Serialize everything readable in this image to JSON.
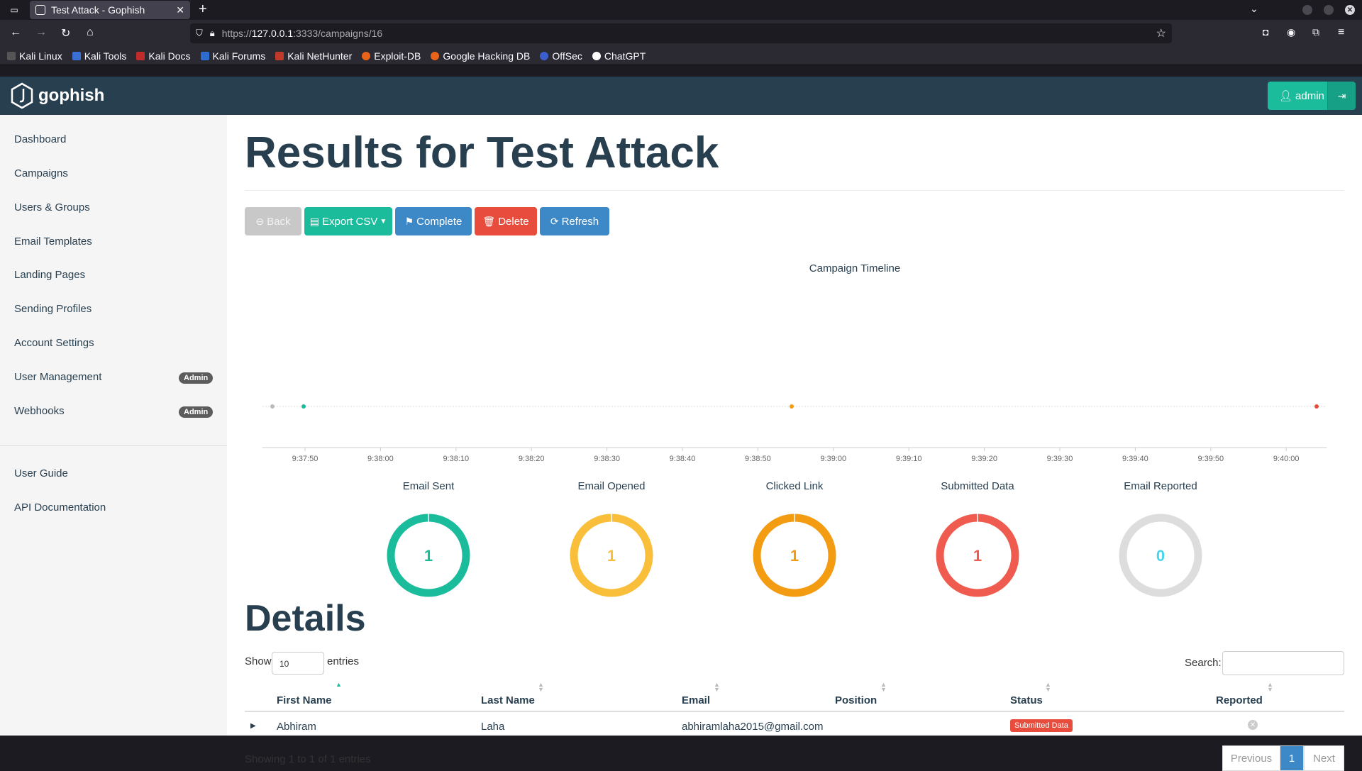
{
  "browser": {
    "tab_title": "Test Attack - Gophish",
    "url_prefix": "https://",
    "url_host": "127.0.0.1",
    "url_rest": ":3333/campaigns/16",
    "bookmarks": [
      "Kali Linux",
      "Kali Tools",
      "Kali Docs",
      "Kali Forums",
      "Kali NetHunter",
      "Exploit-DB",
      "Google Hacking DB",
      "OffSec",
      "ChatGPT"
    ]
  },
  "app": {
    "brand": "gophish",
    "user_label": "admin"
  },
  "sidebar": {
    "items": [
      {
        "label": "Dashboard"
      },
      {
        "label": "Campaigns"
      },
      {
        "label": "Users & Groups"
      },
      {
        "label": "Email Templates"
      },
      {
        "label": "Landing Pages"
      },
      {
        "label": "Sending Profiles"
      },
      {
        "label": "Account Settings"
      },
      {
        "label": "User Management",
        "badge": "Admin"
      },
      {
        "label": "Webhooks",
        "badge": "Admin"
      }
    ],
    "footer": [
      {
        "label": "User Guide"
      },
      {
        "label": "API Documentation"
      }
    ]
  },
  "page": {
    "title": "Results for Test Attack",
    "buttons": {
      "back": "Back",
      "export": "Export CSV",
      "complete": "Complete",
      "delete": "Delete",
      "refresh": "Refresh"
    },
    "timeline_title": "Campaign Timeline",
    "timeline_ticks": [
      "9:37:50",
      "9:38:00",
      "9:38:10",
      "9:38:20",
      "9:38:30",
      "9:38:40",
      "9:38:50",
      "9:39:00",
      "9:39:10",
      "9:39:20",
      "9:39:30",
      "9:39:40",
      "9:39:50",
      "9:40:00"
    ],
    "stats": [
      {
        "label": "Email Sent",
        "value": "1",
        "color": "#1abc9c"
      },
      {
        "label": "Email Opened",
        "value": "1",
        "color": "#f9bf3b"
      },
      {
        "label": "Clicked Link",
        "value": "1",
        "color": "#f39c12"
      },
      {
        "label": "Submitted Data",
        "value": "1",
        "color": "#f05b4f"
      },
      {
        "label": "Email Reported",
        "value": "0",
        "color": "#45d6ef"
      }
    ],
    "details_title": "Details",
    "show_label": "Show",
    "show_value": "10",
    "entries_label": "entries",
    "search_label": "Search:",
    "columns": [
      "First Name",
      "Last Name",
      "Email",
      "Position",
      "Status",
      "Reported"
    ],
    "rows": [
      {
        "first": "Abhiram",
        "last": "Laha",
        "email": "abhiramlaha2015@gmail.com",
        "position": "",
        "status": "Submitted Data"
      }
    ],
    "showing": "Showing 1 to 1 of 1 entries",
    "pagination": {
      "previous": "Previous",
      "current": "1",
      "next": "Next"
    }
  }
}
